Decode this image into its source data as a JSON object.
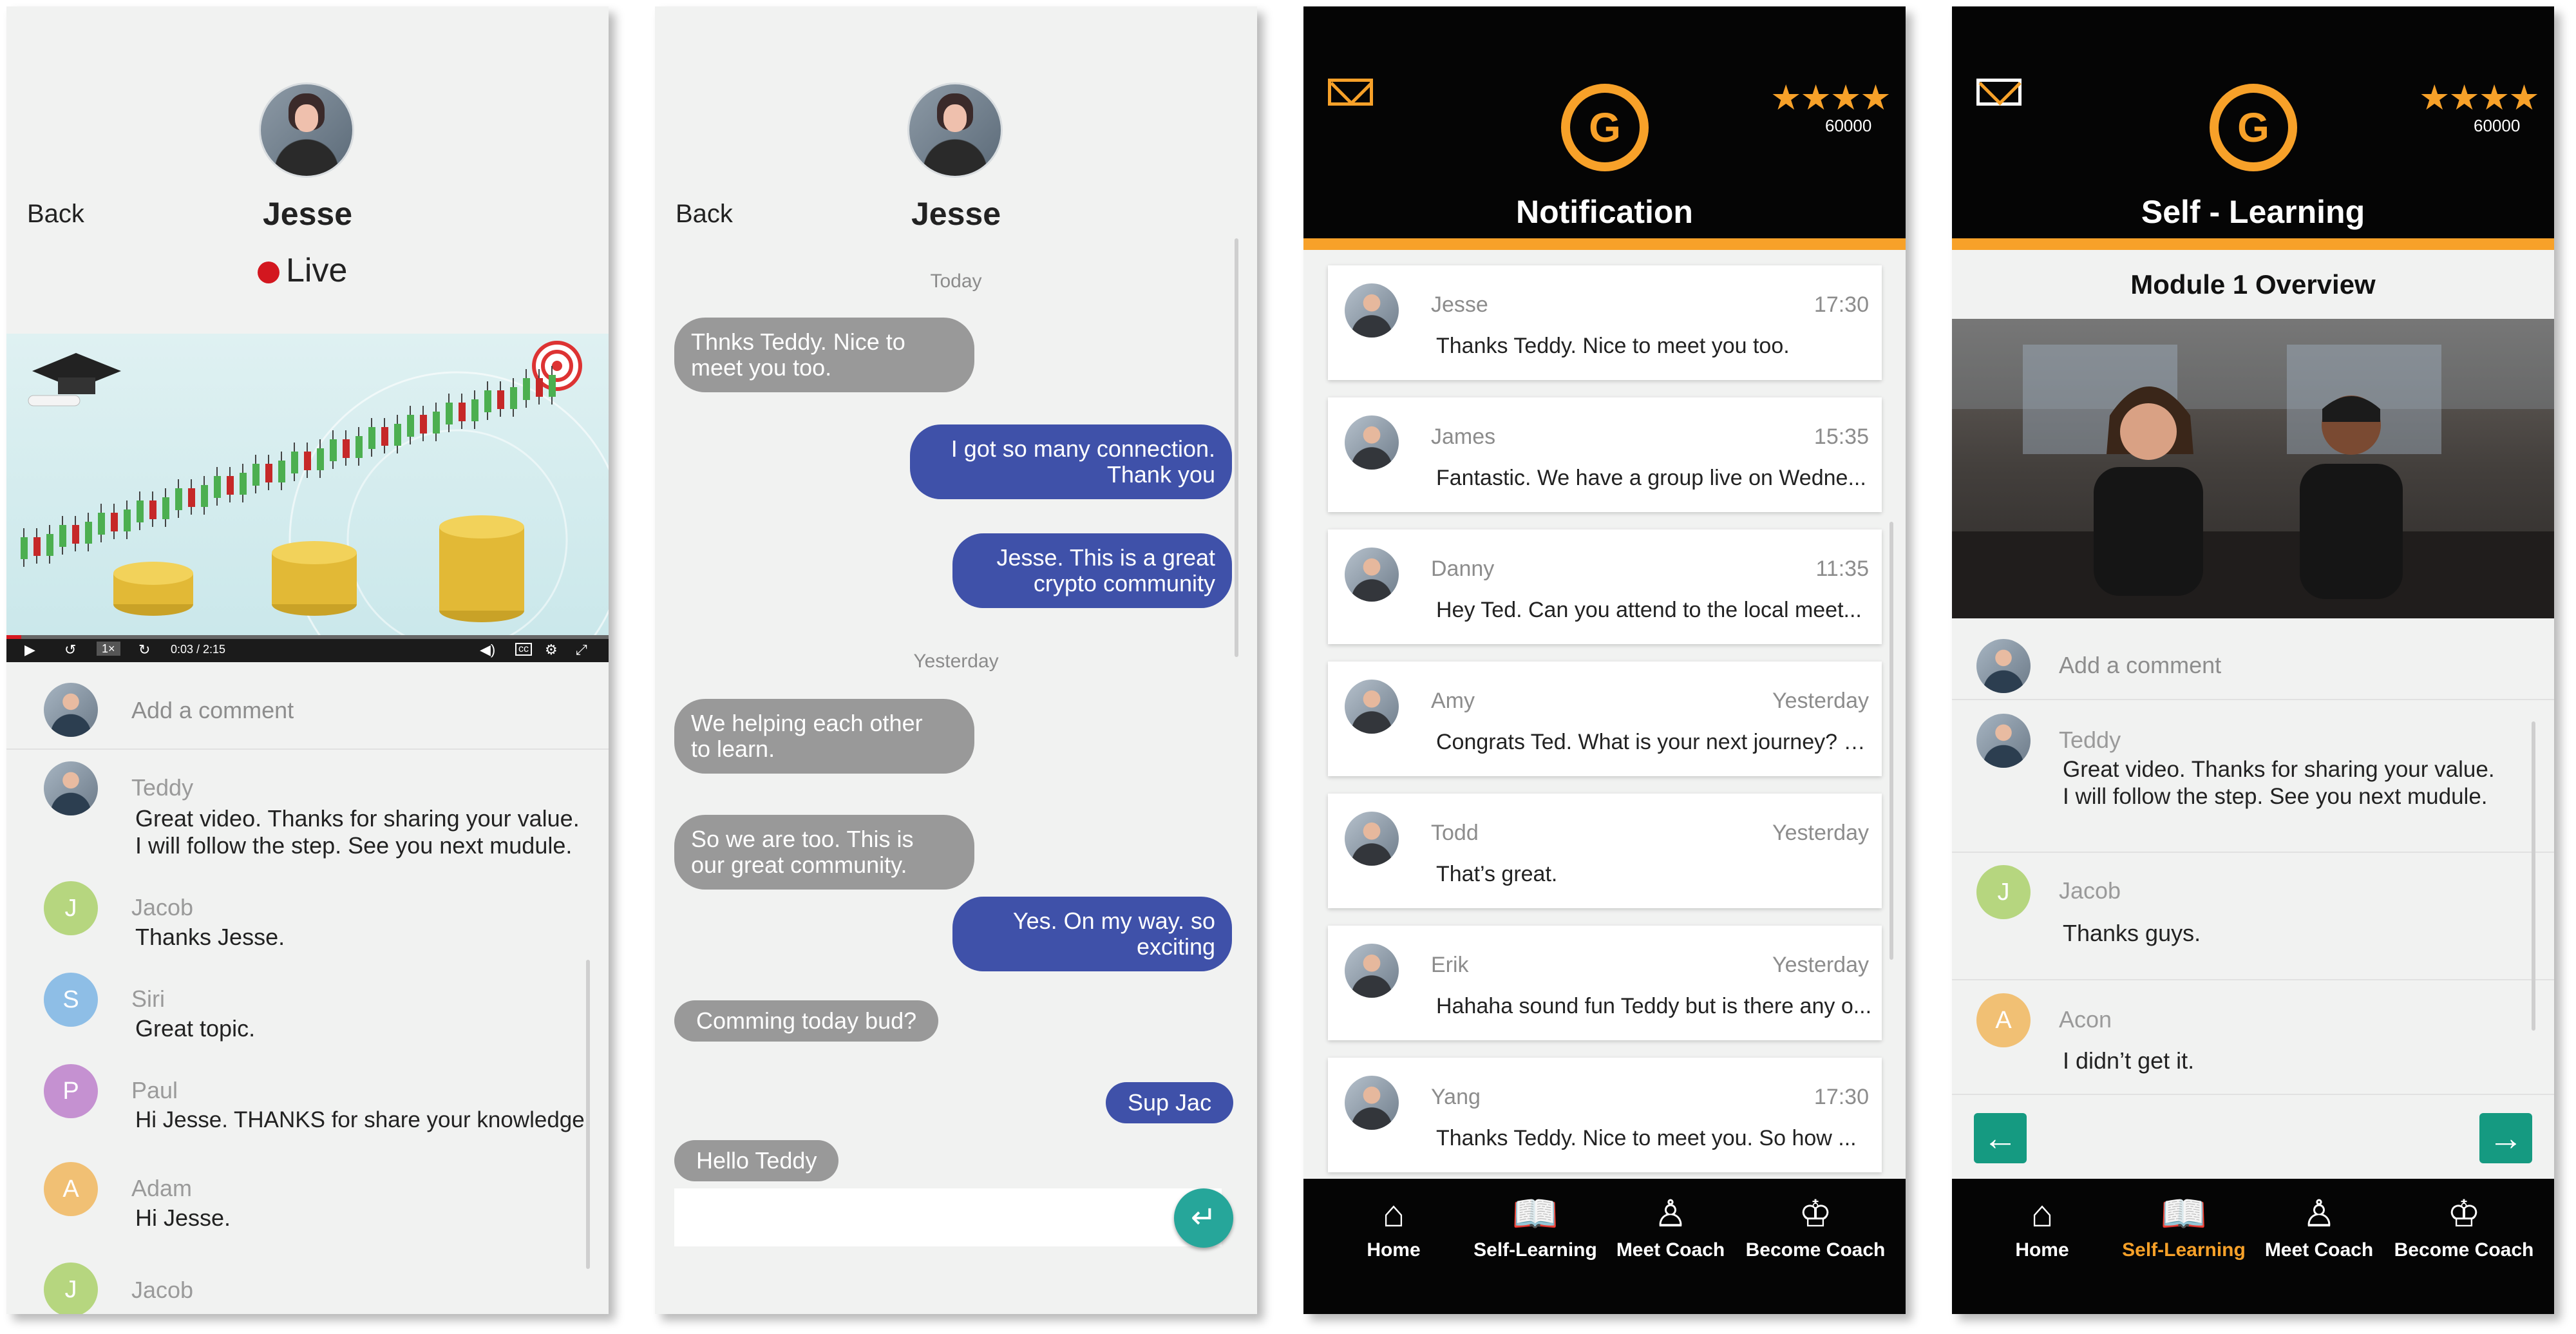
{
  "screen1": {
    "back": "Back",
    "name": "Jesse",
    "live": "Live",
    "video": {
      "time": "0:03 / 2:15",
      "speed": "1×",
      "progress": 0.025
    },
    "add_comment": "Add a comment",
    "comments": [
      {
        "name": "Teddy",
        "text1": "Great video. Thanks for sharing your value.",
        "text2": "I will follow the step. See you next mudule."
      },
      {
        "name": "Jacob",
        "initial": "J",
        "color": "#b6d67f",
        "text": "Thanks Jesse."
      },
      {
        "name": "Siri",
        "initial": "S",
        "color": "#8ebee6",
        "text": "Great topic."
      },
      {
        "name": "Paul",
        "initial": "P",
        "color": "#c591d1",
        "text": "Hi Jesse. THANKS for share your knowledge"
      },
      {
        "name": "Adam",
        "initial": "A",
        "color": "#f1c074",
        "text": "Hi Jesse."
      },
      {
        "name": "Jacob",
        "initial": "J",
        "color": "#b6d67f"
      }
    ]
  },
  "screen2": {
    "back": "Back",
    "name": "Jesse",
    "today": "Today",
    "yesterday": "Yesterday",
    "messages": [
      {
        "line1": "Thnks Teddy. Nice to",
        "line2": "meet you too."
      },
      {
        "line1": "I got so many connection.",
        "line2": "Thank you"
      },
      {
        "line1": "Jesse. This is a great",
        "line2": "crypto community"
      },
      {
        "line1": "We helping each other",
        "line2": "to learn."
      },
      {
        "line1": "So we are too. This is",
        "line2": "our great community."
      },
      {
        "line1": "Yes. On my way. so",
        "line2": "exciting"
      },
      {
        "line1": "Comming today bud?"
      },
      {
        "line1": "Sup Jac"
      },
      {
        "line1": "Hello Teddy"
      }
    ]
  },
  "header": {
    "points": "60000",
    "rating": 4,
    "stars": "★★★★",
    "logo": "G"
  },
  "screen3": {
    "title": "Notification",
    "notifications": [
      {
        "name": "Jesse",
        "time": "17:30",
        "text": "Thanks Teddy. Nice to meet you too."
      },
      {
        "name": "James",
        "time": "15:35",
        "text": "Fantastic. We have a group live on Wedne..."
      },
      {
        "name": "Danny",
        "time": "11:35",
        "text": "Hey Ted. Can you attend to the local meet..."
      },
      {
        "name": "Amy",
        "time": "Yesterday",
        "text": "Congrats Ted. What is your next journey? S..."
      },
      {
        "name": "Todd",
        "time": "Yesterday",
        "text": "That’s great."
      },
      {
        "name": "Erik",
        "time": "Yesterday",
        "text": "Hahaha sound fun Teddy but is there any o..."
      },
      {
        "name": "Yang",
        "time": "17:30",
        "text": "Thanks Teddy. Nice to meet you.  So how ..."
      }
    ]
  },
  "nav": {
    "home": "Home",
    "self_learning": "Self-Learning",
    "meet_coach": "Meet Coach",
    "become_coach": "Become Coach"
  },
  "screen4": {
    "title": "Self - Learning",
    "module": "Module 1 Overview",
    "add_comment": "Add a comment",
    "comments": [
      {
        "name": "Teddy",
        "text1": "Great video. Thanks for sharing your value.",
        "text2": "I will follow the step. See you next mudule."
      },
      {
        "name": "Jacob",
        "initial": "J",
        "color": "#b6d67f",
        "text": "Thanks guys."
      },
      {
        "name": "Acon",
        "initial": "A",
        "color": "#f1c074",
        "text": "I didn’t get it."
      }
    ]
  },
  "colors": {
    "accent": "#f7a129",
    "chat_out": "#3f51a9",
    "chat_in": "#999999",
    "teal": "#26a69a",
    "arrow": "#159a81",
    "live": "#d3171f"
  }
}
